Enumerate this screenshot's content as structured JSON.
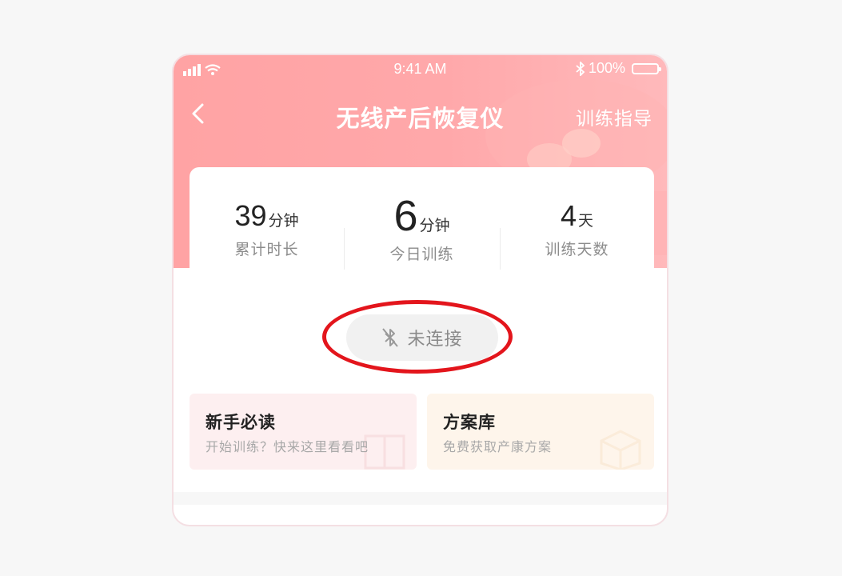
{
  "status_bar": {
    "time": "9:41 AM",
    "battery": "100%",
    "signal_icon": "signal-icon",
    "wifi_icon": "wifi-icon",
    "bluetooth_icon": "bluetooth-icon"
  },
  "nav": {
    "title": "无线产后恢复仪",
    "right_link": "训练指导",
    "back_icon": "back-chevron-icon"
  },
  "stats": [
    {
      "value": "39",
      "unit": "分钟",
      "label": "累计时长"
    },
    {
      "value": "6",
      "unit": "分钟",
      "label": "今日训练"
    },
    {
      "value": "4",
      "unit": "天",
      "label": "训练天数"
    }
  ],
  "connect": {
    "label": "未连接",
    "icon": "bluetooth-off-icon"
  },
  "tiles": [
    {
      "title": "新手必读",
      "subtitle": "开始训练？快来这里看看吧"
    },
    {
      "title": "方案库",
      "subtitle": "免费获取产康方案"
    }
  ],
  "colors": {
    "header": "#ffa3a4",
    "highlight_ring": "#e3151c",
    "tile_pink": "#fdeff0",
    "tile_peach": "#fef5eb"
  }
}
